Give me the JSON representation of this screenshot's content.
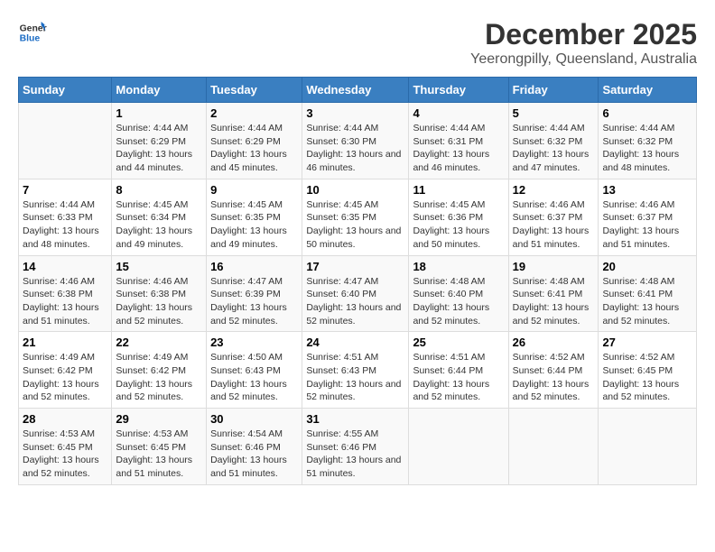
{
  "header": {
    "logo_general": "General",
    "logo_blue": "Blue",
    "title": "December 2025",
    "subtitle": "Yeerongpilly, Queensland, Australia"
  },
  "calendar": {
    "headers": [
      "Sunday",
      "Monday",
      "Tuesday",
      "Wednesday",
      "Thursday",
      "Friday",
      "Saturday"
    ],
    "weeks": [
      [
        {
          "day": "",
          "sunrise": "",
          "sunset": "",
          "daylight": ""
        },
        {
          "day": "1",
          "sunrise": "Sunrise: 4:44 AM",
          "sunset": "Sunset: 6:29 PM",
          "daylight": "Daylight: 13 hours and 44 minutes."
        },
        {
          "day": "2",
          "sunrise": "Sunrise: 4:44 AM",
          "sunset": "Sunset: 6:29 PM",
          "daylight": "Daylight: 13 hours and 45 minutes."
        },
        {
          "day": "3",
          "sunrise": "Sunrise: 4:44 AM",
          "sunset": "Sunset: 6:30 PM",
          "daylight": "Daylight: 13 hours and 46 minutes."
        },
        {
          "day": "4",
          "sunrise": "Sunrise: 4:44 AM",
          "sunset": "Sunset: 6:31 PM",
          "daylight": "Daylight: 13 hours and 46 minutes."
        },
        {
          "day": "5",
          "sunrise": "Sunrise: 4:44 AM",
          "sunset": "Sunset: 6:32 PM",
          "daylight": "Daylight: 13 hours and 47 minutes."
        },
        {
          "day": "6",
          "sunrise": "Sunrise: 4:44 AM",
          "sunset": "Sunset: 6:32 PM",
          "daylight": "Daylight: 13 hours and 48 minutes."
        }
      ],
      [
        {
          "day": "7",
          "sunrise": "Sunrise: 4:44 AM",
          "sunset": "Sunset: 6:33 PM",
          "daylight": "Daylight: 13 hours and 48 minutes."
        },
        {
          "day": "8",
          "sunrise": "Sunrise: 4:45 AM",
          "sunset": "Sunset: 6:34 PM",
          "daylight": "Daylight: 13 hours and 49 minutes."
        },
        {
          "day": "9",
          "sunrise": "Sunrise: 4:45 AM",
          "sunset": "Sunset: 6:35 PM",
          "daylight": "Daylight: 13 hours and 49 minutes."
        },
        {
          "day": "10",
          "sunrise": "Sunrise: 4:45 AM",
          "sunset": "Sunset: 6:35 PM",
          "daylight": "Daylight: 13 hours and 50 minutes."
        },
        {
          "day": "11",
          "sunrise": "Sunrise: 4:45 AM",
          "sunset": "Sunset: 6:36 PM",
          "daylight": "Daylight: 13 hours and 50 minutes."
        },
        {
          "day": "12",
          "sunrise": "Sunrise: 4:46 AM",
          "sunset": "Sunset: 6:37 PM",
          "daylight": "Daylight: 13 hours and 51 minutes."
        },
        {
          "day": "13",
          "sunrise": "Sunrise: 4:46 AM",
          "sunset": "Sunset: 6:37 PM",
          "daylight": "Daylight: 13 hours and 51 minutes."
        }
      ],
      [
        {
          "day": "14",
          "sunrise": "Sunrise: 4:46 AM",
          "sunset": "Sunset: 6:38 PM",
          "daylight": "Daylight: 13 hours and 51 minutes."
        },
        {
          "day": "15",
          "sunrise": "Sunrise: 4:46 AM",
          "sunset": "Sunset: 6:38 PM",
          "daylight": "Daylight: 13 hours and 52 minutes."
        },
        {
          "day": "16",
          "sunrise": "Sunrise: 4:47 AM",
          "sunset": "Sunset: 6:39 PM",
          "daylight": "Daylight: 13 hours and 52 minutes."
        },
        {
          "day": "17",
          "sunrise": "Sunrise: 4:47 AM",
          "sunset": "Sunset: 6:40 PM",
          "daylight": "Daylight: 13 hours and 52 minutes."
        },
        {
          "day": "18",
          "sunrise": "Sunrise: 4:48 AM",
          "sunset": "Sunset: 6:40 PM",
          "daylight": "Daylight: 13 hours and 52 minutes."
        },
        {
          "day": "19",
          "sunrise": "Sunrise: 4:48 AM",
          "sunset": "Sunset: 6:41 PM",
          "daylight": "Daylight: 13 hours and 52 minutes."
        },
        {
          "day": "20",
          "sunrise": "Sunrise: 4:48 AM",
          "sunset": "Sunset: 6:41 PM",
          "daylight": "Daylight: 13 hours and 52 minutes."
        }
      ],
      [
        {
          "day": "21",
          "sunrise": "Sunrise: 4:49 AM",
          "sunset": "Sunset: 6:42 PM",
          "daylight": "Daylight: 13 hours and 52 minutes."
        },
        {
          "day": "22",
          "sunrise": "Sunrise: 4:49 AM",
          "sunset": "Sunset: 6:42 PM",
          "daylight": "Daylight: 13 hours and 52 minutes."
        },
        {
          "day": "23",
          "sunrise": "Sunrise: 4:50 AM",
          "sunset": "Sunset: 6:43 PM",
          "daylight": "Daylight: 13 hours and 52 minutes."
        },
        {
          "day": "24",
          "sunrise": "Sunrise: 4:51 AM",
          "sunset": "Sunset: 6:43 PM",
          "daylight": "Daylight: 13 hours and 52 minutes."
        },
        {
          "day": "25",
          "sunrise": "Sunrise: 4:51 AM",
          "sunset": "Sunset: 6:44 PM",
          "daylight": "Daylight: 13 hours and 52 minutes."
        },
        {
          "day": "26",
          "sunrise": "Sunrise: 4:52 AM",
          "sunset": "Sunset: 6:44 PM",
          "daylight": "Daylight: 13 hours and 52 minutes."
        },
        {
          "day": "27",
          "sunrise": "Sunrise: 4:52 AM",
          "sunset": "Sunset: 6:45 PM",
          "daylight": "Daylight: 13 hours and 52 minutes."
        }
      ],
      [
        {
          "day": "28",
          "sunrise": "Sunrise: 4:53 AM",
          "sunset": "Sunset: 6:45 PM",
          "daylight": "Daylight: 13 hours and 52 minutes."
        },
        {
          "day": "29",
          "sunrise": "Sunrise: 4:53 AM",
          "sunset": "Sunset: 6:45 PM",
          "daylight": "Daylight: 13 hours and 51 minutes."
        },
        {
          "day": "30",
          "sunrise": "Sunrise: 4:54 AM",
          "sunset": "Sunset: 6:46 PM",
          "daylight": "Daylight: 13 hours and 51 minutes."
        },
        {
          "day": "31",
          "sunrise": "Sunrise: 4:55 AM",
          "sunset": "Sunset: 6:46 PM",
          "daylight": "Daylight: 13 hours and 51 minutes."
        },
        {
          "day": "",
          "sunrise": "",
          "sunset": "",
          "daylight": ""
        },
        {
          "day": "",
          "sunrise": "",
          "sunset": "",
          "daylight": ""
        },
        {
          "day": "",
          "sunrise": "",
          "sunset": "",
          "daylight": ""
        }
      ]
    ]
  }
}
